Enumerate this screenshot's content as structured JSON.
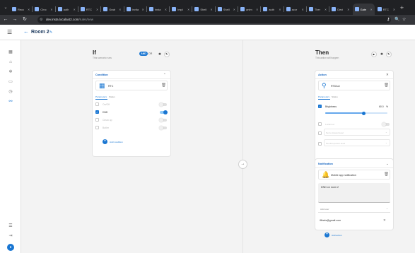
{
  "browser": {
    "tabs": [
      {
        "label": "Recc"
      },
      {
        "label": "Chrc"
      },
      {
        "label": "auth"
      },
      {
        "label": "RTC"
      },
      {
        "label": "Grab"
      },
      {
        "label": "Invita"
      },
      {
        "label": "Insta"
      },
      {
        "label": "Impl"
      },
      {
        "label": "Shell"
      },
      {
        "label": "Shell"
      },
      {
        "label": "anim"
      },
      {
        "label": "auth"
      },
      {
        "label": "accr"
      },
      {
        "label": "Ther"
      },
      {
        "label": "Devi"
      },
      {
        "label": "Gate"
      },
      {
        "label": "RTC"
      }
    ],
    "url_host": "dev.insta.localai42.com",
    "url_path": "/rules/new"
  },
  "app": {
    "page_title": "Room 2"
  },
  "if_column": {
    "title": "If",
    "subtitle": "This scenario runs",
    "and_label": "AND",
    "or_label": "OR",
    "condition_card": {
      "title": "Condition",
      "device_name": "RTC",
      "tabs": [
        "Parameters",
        "Status"
      ],
      "properties": [
        {
          "label": "On/Off",
          "checked": false,
          "switch_on": false
        },
        {
          "label": "DND",
          "checked": true,
          "switch_on": true
        },
        {
          "label": "Clean up",
          "checked": false,
          "switch_on": false
        },
        {
          "label": "Butler",
          "checked": false,
          "switch_on": false
        }
      ]
    },
    "add_condition_label": "Add condition"
  },
  "then_column": {
    "title": "Then",
    "subtitle": "This action will happen",
    "action_card": {
      "title": "Action",
      "device_name": "RTDALI",
      "tabs": [
        "Parameters",
        "Status"
      ],
      "brightness_label": "Brightness",
      "brightness_value": "60.0",
      "brightness_unit": "%",
      "brightness_level": 0.62,
      "extra_fields": [
        {
          "label": "Lockmod"
        },
        {
          "label": "Set to lowest level"
        },
        {
          "label": "Set dim-power level"
        }
      ]
    },
    "notification_card": {
      "title": "Notification",
      "type_label": "Mobile app notification",
      "message": "DND on room 2",
      "add_user_label": "Add user",
      "email": "iffinels@gmail.com"
    },
    "add_action_label": "Add action"
  },
  "colors": {
    "accent": "#1976d2",
    "background": "#f3f3f3"
  }
}
